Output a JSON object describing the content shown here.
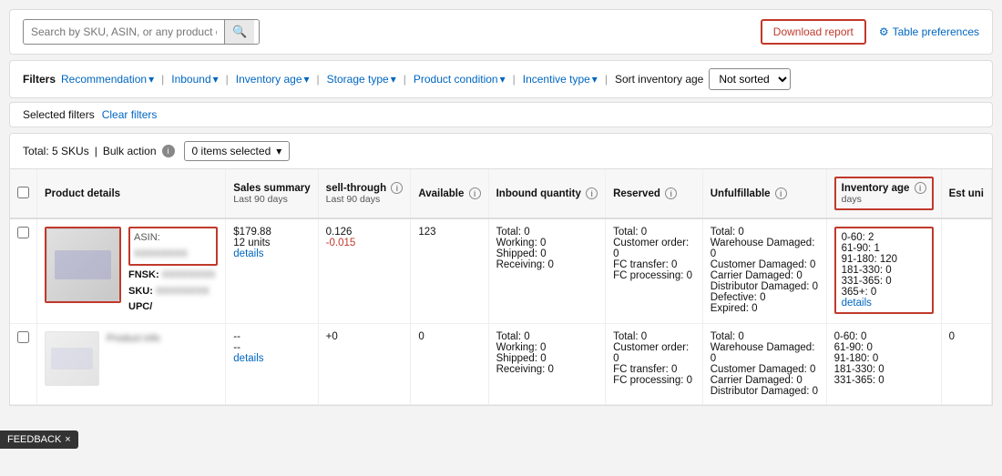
{
  "search": {
    "placeholder": "Search by SKU, ASIN, or any product detail"
  },
  "top_right": {
    "download_label": "Download report",
    "table_prefs_label": "Table preferences"
  },
  "filters": {
    "label": "Filters",
    "items": [
      {
        "id": "recommendation",
        "label": "Recommendation",
        "has_arrow": true
      },
      {
        "id": "inbound",
        "label": "Inbound",
        "has_arrow": true
      },
      {
        "id": "inventory_age",
        "label": "Inventory age",
        "has_arrow": true
      },
      {
        "id": "storage_type",
        "label": "Storage type",
        "has_arrow": true
      },
      {
        "id": "product_condition",
        "label": "Product condition",
        "has_arrow": true
      },
      {
        "id": "incentive_type",
        "label": "Incentive type",
        "has_arrow": true
      }
    ],
    "sort_label": "Sort inventory age",
    "sort_value": "Not sorted"
  },
  "selected_filters": {
    "label": "Selected filters",
    "clear_label": "Clear filters"
  },
  "bulk_bar": {
    "total_label": "Total: 5 SKUs",
    "bulk_label": "Bulk action",
    "items_selected": "0 items selected"
  },
  "table": {
    "columns": [
      {
        "id": "product",
        "label": "Product details",
        "sublabel": ""
      },
      {
        "id": "sales",
        "label": "Sales summary",
        "sublabel": "Last 90 days"
      },
      {
        "id": "sellthrough",
        "label": "sell-through",
        "sublabel": "Last 90 days",
        "info": true
      },
      {
        "id": "available",
        "label": "Available",
        "sublabel": "",
        "info": true
      },
      {
        "id": "inbound",
        "label": "Inbound quantity",
        "sublabel": "",
        "info": true
      },
      {
        "id": "reserved",
        "label": "Reserved",
        "sublabel": "",
        "info": true
      },
      {
        "id": "unfulfillable",
        "label": "Unfulfillable",
        "sublabel": "",
        "info": true
      },
      {
        "id": "invage",
        "label": "Inventory age",
        "sublabel": "days",
        "info": true
      },
      {
        "id": "est",
        "label": "Est uni",
        "sublabel": ""
      }
    ],
    "rows": [
      {
        "id": "row1",
        "has_image": true,
        "asin_label": "ASIN:",
        "asin_value": "XXXXXXXX",
        "fnsku_label": "FNSK:",
        "fnsku_value": "XXXXXXXX",
        "sku_label": "SKU:",
        "sku_value": "XXXXXXXX",
        "upc_label": "UPC/",
        "upc_value": "",
        "sales_price": "$179.88",
        "sales_units": "12 units",
        "sales_details": "details",
        "sellthrough": "0.126",
        "sellthrough_delta": "-0.015",
        "available": "123",
        "inbound_total": "Total: 0",
        "inbound_working": "Working: 0",
        "inbound_shipped": "Shipped: 0",
        "inbound_receiving": "Receiving: 0",
        "reserved_total": "Total: 0",
        "reserved_customer": "Customer order: 0",
        "reserved_fc": "FC transfer: 0",
        "reserved_fcp": "FC processing: 0",
        "unfulfillable_total": "Total: 0",
        "unfulfillable_wh": "Warehouse Damaged: 0",
        "unfulfillable_cd": "Customer Damaged: 0",
        "unfulfillable_carrier": "Carrier Damaged: 0",
        "unfulfillable_dist": "Distributor Damaged: 0",
        "unfulfillable_def": "Defective: 0",
        "unfulfillable_exp": "Expired: 0",
        "invage_0_60": "0-60: 2",
        "invage_61_90": "61-90: 1",
        "invage_91_180": "91-180: 120",
        "invage_181_330": "181-330: 0",
        "invage_331_365": "331-365: 0",
        "invage_365plus": "365+: 0",
        "invage_details": "details",
        "est": "",
        "highlight_product": true,
        "highlight_invage": true
      },
      {
        "id": "row2",
        "has_image": true,
        "asin_label": "",
        "sales_price": "--",
        "sales_units": "--",
        "sales_details": "details",
        "sellthrough": "+0",
        "available": "0",
        "inbound_total": "Total: 0",
        "inbound_working": "Working: 0",
        "inbound_shipped": "Shipped: 0",
        "inbound_receiving": "Receiving: 0",
        "reserved_total": "Total: 0",
        "reserved_customer": "Customer order: 0",
        "reserved_fc": "FC transfer: 0",
        "reserved_fcp": "FC processing: 0",
        "unfulfillable_total": "Total: 0",
        "unfulfillable_wh": "Warehouse Damaged: 0",
        "unfulfillable_cd": "Customer Damaged: 0",
        "unfulfillable_carrier": "Carrier Damaged: 0",
        "unfulfillable_dist": "Distributor Damaged: 0",
        "invage_0_60": "0-60: 0",
        "invage_61_90": "61-90: 0",
        "invage_91_180": "91-180: 0",
        "invage_181_330": "181-330: 0",
        "invage_331_365": "331-365: 0",
        "est": "0",
        "highlight_product": false,
        "highlight_invage": false
      }
    ]
  },
  "feedback": {
    "label": "FEEDBACK",
    "close": "×"
  }
}
